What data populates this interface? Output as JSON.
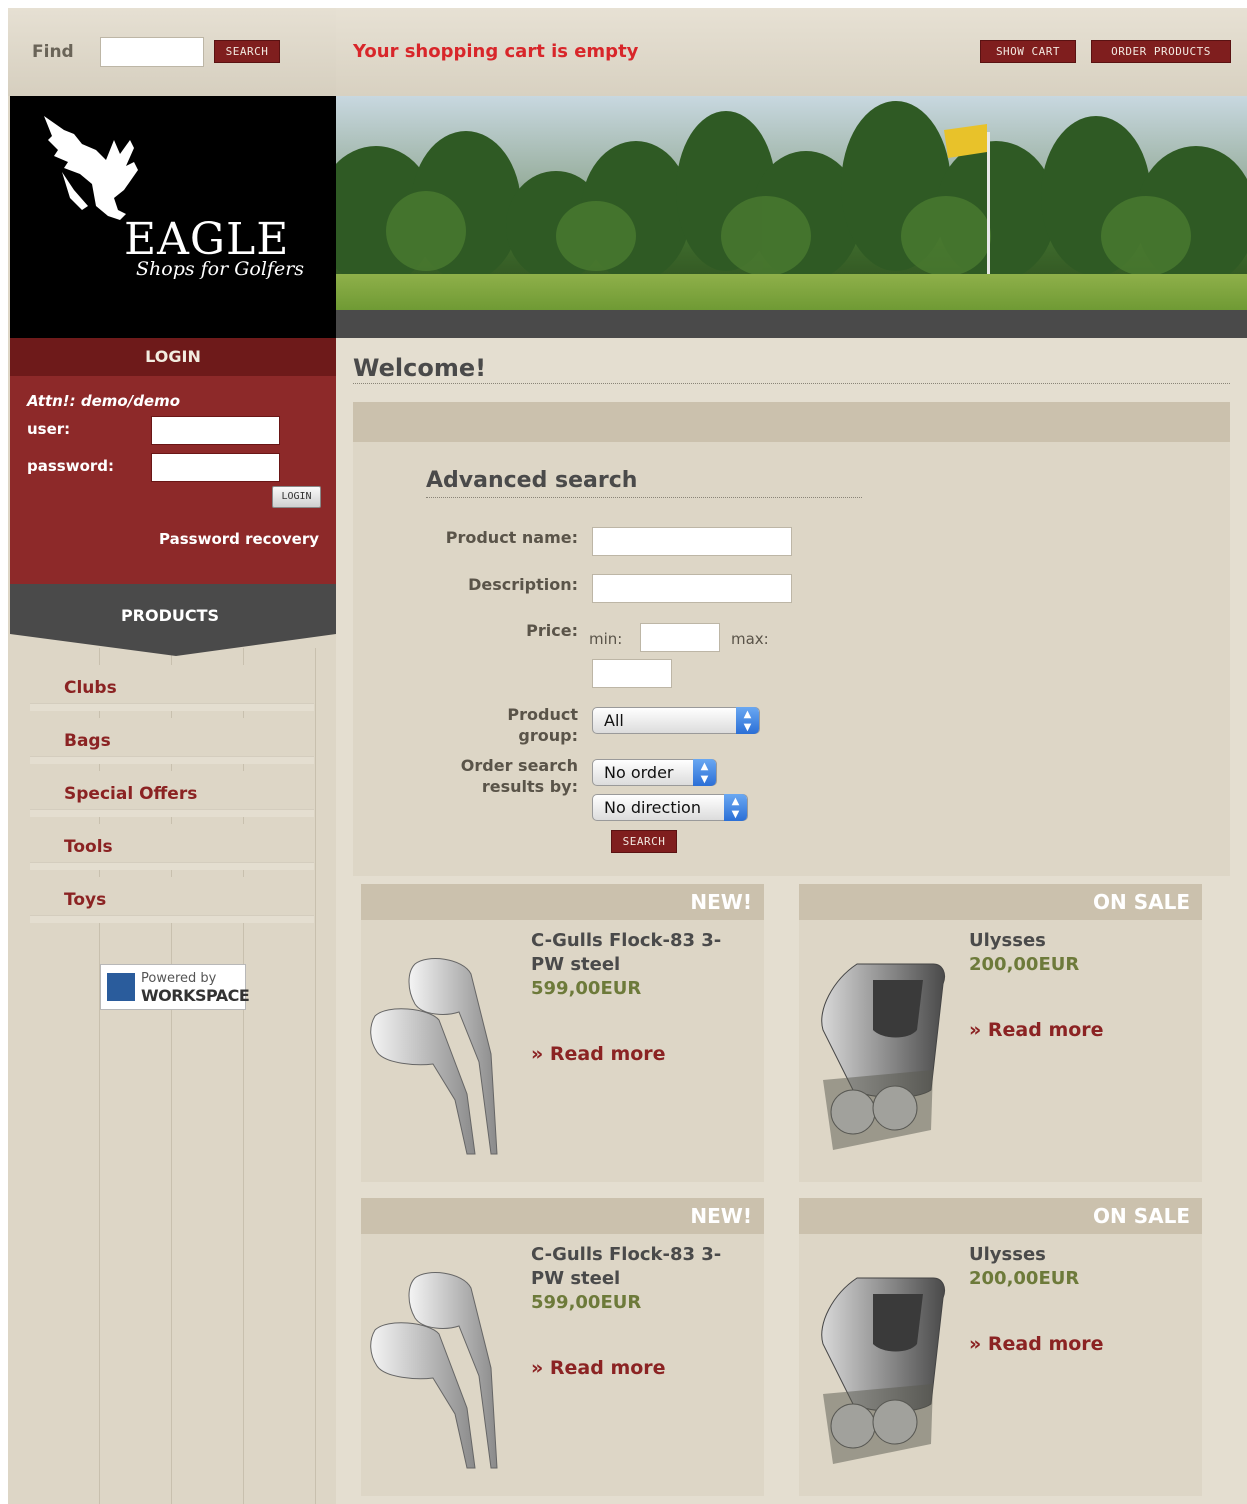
{
  "search_bar": {
    "label": "Find",
    "button": "search"
  },
  "cart": {
    "status": "Your shopping cart is empty",
    "show_cart": "show cart",
    "order_products": "order products"
  },
  "logo": {
    "brand": "EAGLE",
    "tagline": "Shops for Golfers"
  },
  "login": {
    "heading": "LOGIN",
    "note": "Attn!: demo/demo",
    "user_label": "user:",
    "password_label": "password:",
    "button": "login",
    "recovery": "Password recovery"
  },
  "products_nav": {
    "heading": "PRODUCTS",
    "items": [
      {
        "label": "Clubs"
      },
      {
        "label": "Bags"
      },
      {
        "label": "Special Offers"
      },
      {
        "label": "Tools"
      },
      {
        "label": "Toys"
      }
    ]
  },
  "powered": {
    "line1": "Powered by",
    "line2": "WORKSPACE"
  },
  "main": {
    "welcome": "Welcome!"
  },
  "advanced_search": {
    "title": "Advanced search",
    "product_name": "Product name:",
    "description": "Description:",
    "price": "Price:",
    "min": "min:",
    "max": "max:",
    "product_group_1": "Product",
    "product_group_2": "group:",
    "order_1": "Order search",
    "order_2": "results by:",
    "group_value": "All",
    "order_value": "No order",
    "direction_value": "No direction",
    "button": "search"
  },
  "cards": [
    {
      "badge": "NEW!",
      "name": "C-Gulls Flock-83 3-PW steel",
      "price": "599,00EUR",
      "more": "» Read more",
      "image": "golf-irons"
    },
    {
      "badge": "ON SALE",
      "name": "Ulysses",
      "price": "200,00EUR",
      "more": "» Read more",
      "image": "putter-head"
    },
    {
      "badge": "NEW!",
      "name": "C-Gulls Flock-83 3-PW steel",
      "price": "599,00EUR",
      "more": "» Read more",
      "image": "golf-irons"
    },
    {
      "badge": "ON SALE",
      "name": "Ulysses",
      "price": "200,00EUR",
      "more": "» Read more",
      "image": "putter-head"
    }
  ],
  "colors": {
    "accent_red": "#7f1e1e",
    "cart_message": "#d8262a",
    "price_green": "#6d7a3a",
    "link_red": "#8b2323"
  }
}
